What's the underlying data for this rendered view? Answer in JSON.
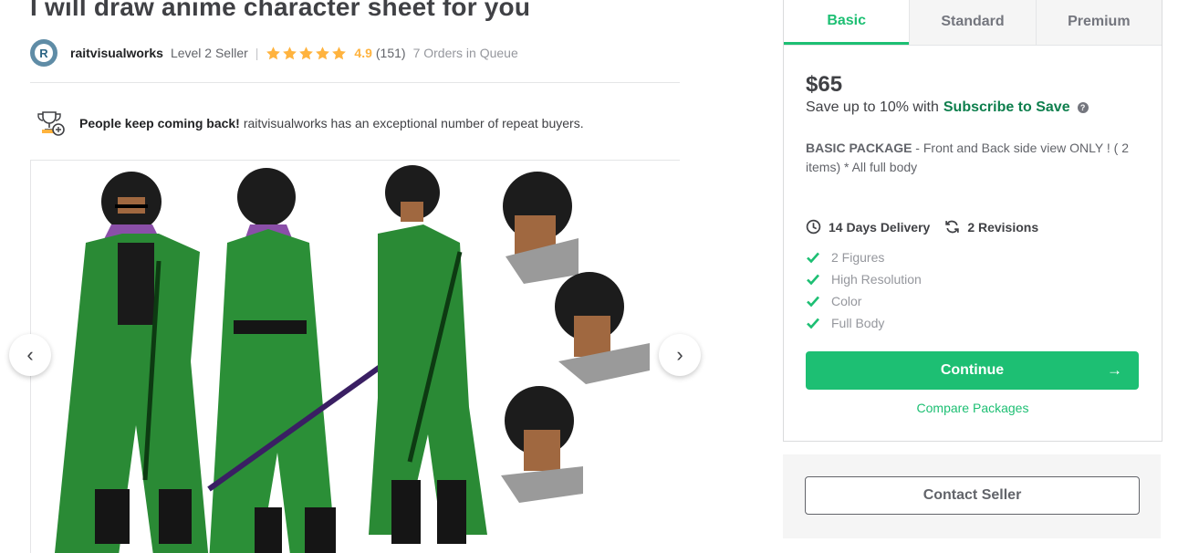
{
  "gig": {
    "title": "I will draw anime character sheet for you"
  },
  "seller": {
    "avatar_letter": "R",
    "name": "raitvisualworks",
    "level": "Level 2 Seller",
    "separator": "|",
    "rating": "4.9",
    "reviews": "(151)",
    "orders_in_queue": "7 Orders in Queue",
    "star_color": "#ffb33e"
  },
  "repeat_buyers": {
    "highlight": "People keep coming back!",
    "text": "raitvisualworks has an exceptional number of repeat buyers."
  },
  "gallery": {
    "prev_icon": "chevron-left-icon",
    "next_icon": "chevron-right-icon",
    "prev_glyph": "‹",
    "next_glyph": "›"
  },
  "packages": {
    "tabs": [
      "Basic",
      "Standard",
      "Premium"
    ],
    "active_tab": "Basic",
    "price": "$65",
    "save_prefix": "Save up to 10% with",
    "save_link": "Subscribe to Save",
    "help_glyph": "?",
    "description_title": "BASIC PACKAGE",
    "description_text": " - Front and Back side view ONLY ! ( 2 items) * All full body",
    "delivery": "14 Days Delivery",
    "revisions": "2 Revisions",
    "features": [
      "2 Figures",
      "High Resolution",
      "Color",
      "Full Body"
    ],
    "continue_label": "Continue",
    "continue_arrow": "→",
    "compare_label": "Compare Packages",
    "contact_label": "Contact Seller",
    "accent_color": "#1dbf73"
  }
}
